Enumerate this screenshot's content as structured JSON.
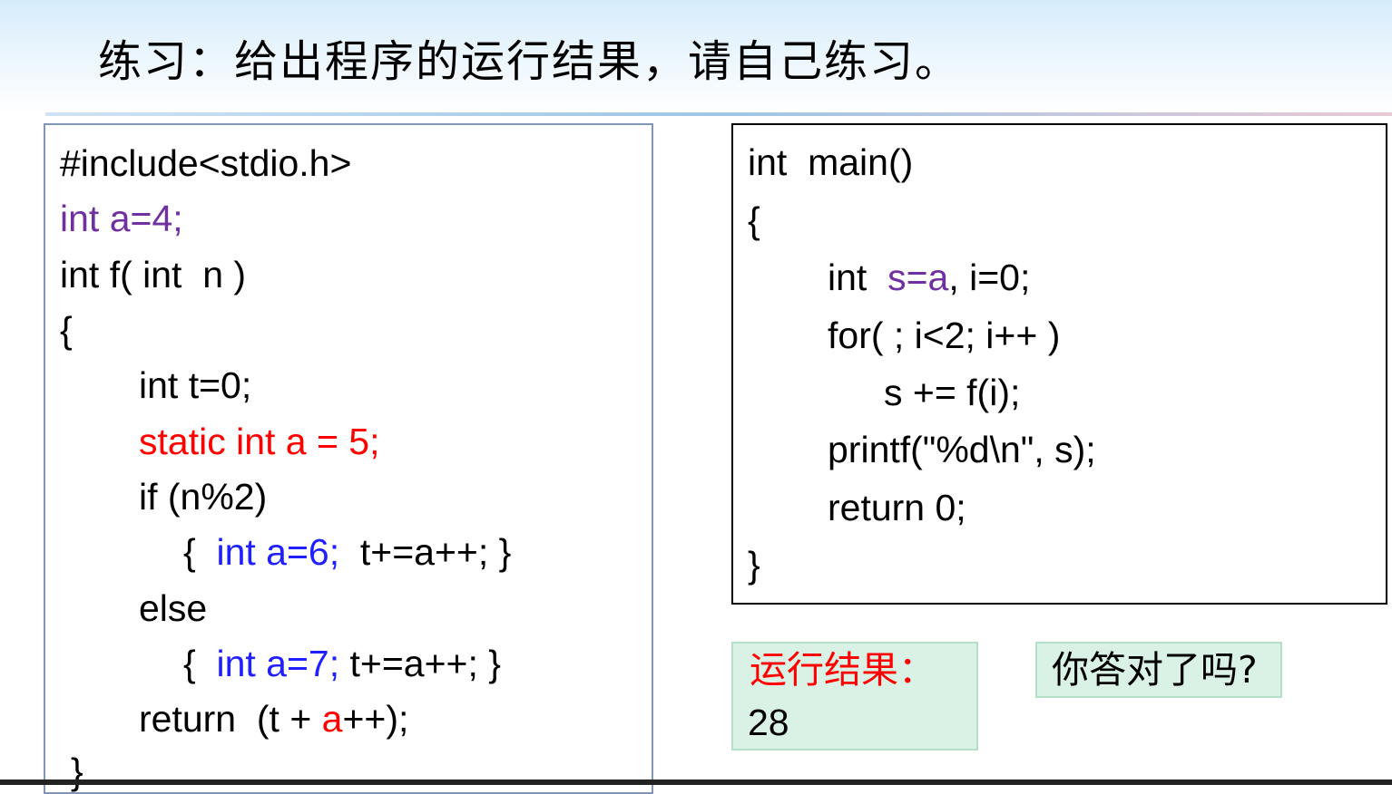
{
  "slide": {
    "title": "练习：给出程序的运行结果，请自己练习。"
  },
  "left_code": {
    "line1": "#include<stdio.h>",
    "line2": "int a=4;",
    "line3": "int f( int  n )",
    "line4": "{",
    "line5": "int t=0;",
    "line6": "static int a = 5;",
    "line7": "if (n%2)",
    "line8_open": "{  ",
    "line8_decl": "int a=6;",
    "line8_rest": "  t+=a++; }",
    "line9": "else",
    "line10_open": "{  ",
    "line10_decl": "int a=7;",
    "line10_rest": " t+=a++; }",
    "line11_pre": "return  (t + ",
    "line11_a": "a",
    "line11_post": "++);",
    "line12": "}"
  },
  "right_code": {
    "line1": "int  main()",
    "line2": "{",
    "line3_pre": "int  ",
    "line3_decl": "s=a",
    "line3_post": ", i=0;",
    "line4": "for( ; i<2; i++ )",
    "line5": "s += f(i);",
    "line6": "printf(\"%d\\n\", s);",
    "line7": "return 0;",
    "line8": "}"
  },
  "result": {
    "label": "运行结果：",
    "value": "28"
  },
  "question": {
    "text": "你答对了吗?"
  },
  "colors": {
    "global_var": "#7030a0",
    "static_var": "#ff0000",
    "local_var": "#1f1fff"
  }
}
